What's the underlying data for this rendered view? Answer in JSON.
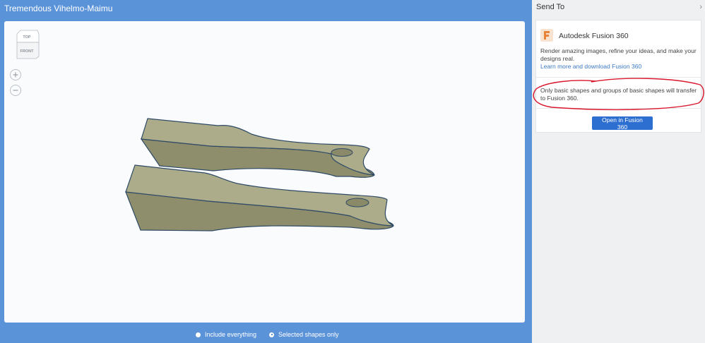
{
  "window": {
    "title": "Tremendous Vihelmo-Maimu"
  },
  "viewcube": {
    "top_label": "TOP",
    "front_label": "FRONT"
  },
  "export_options": [
    {
      "label": "Include everything",
      "selected": false
    },
    {
      "label": "Selected shapes only",
      "selected": true
    }
  ],
  "panel": {
    "title": "Send To",
    "app_name": "Autodesk Fusion 360",
    "description": "Render amazing images, refine your ideas, and make your designs real.",
    "link_text": "Learn more and download Fusion 360",
    "note": "Only basic shapes and groups of basic shapes will transfer to Fusion 360.",
    "open_button": "Open in Fusion 360"
  },
  "icons": {
    "zoom_in": "plus-icon",
    "zoom_out": "minus-icon",
    "logo": "fusion-360-logo-icon"
  },
  "colors": {
    "accent_blue": "#5b93d9",
    "button_blue": "#2d6fd1",
    "model_top": "#acac8a",
    "model_side": "#8e8e6c",
    "model_outline": "#2e4a66",
    "annotation_red": "#d9162c",
    "link": "#3c78c2"
  }
}
